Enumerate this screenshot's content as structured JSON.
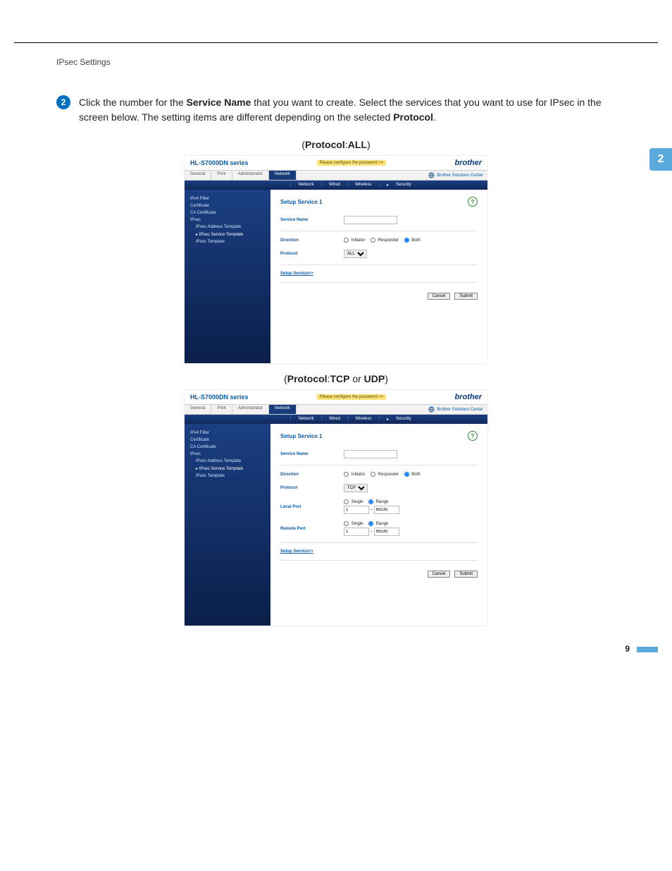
{
  "doc": {
    "header": "IPsec Settings",
    "step_bullet": "2",
    "step_text_prefix": "Click the number for the ",
    "step_bold1": "Service Name",
    "step_text_mid": " that you want to create. Select the services that you want to use for IPsec in the screen below. The setting items are different depending on the selected ",
    "step_bold2": "Protocol",
    "step_text_end": ".",
    "caption1_open": "(",
    "caption1_b1": "Protocol",
    "caption1_sep": ":",
    "caption1_b2": "ALL",
    "caption1_close": ")",
    "caption2_open": "(",
    "caption2_b1": "Protocol",
    "caption2_sep": ":",
    "caption2_b2": "TCP",
    "caption2_or": " or ",
    "caption2_b3": "UDP",
    "caption2_close": ")",
    "side_tab": "2",
    "page_number": "9"
  },
  "shot": {
    "product": "HL-S7000DN series",
    "warn": "Please configure the password >>",
    "brand": "brother",
    "solutions_link": "Brother Solutions Center",
    "tabs": {
      "general": "General",
      "print": "Print",
      "admin": "Administrator",
      "network": "Network"
    },
    "subnav": {
      "network": "Network",
      "wired": "Wired",
      "wireless": "Wireless",
      "security": "Security",
      "marker": "▸"
    },
    "side": {
      "ipv4": "IPv4 Filter",
      "cert": "Certificate",
      "cacert": "CA Certificate",
      "ipsec": "IPsec",
      "addr_tpl": "IPsec Address Template",
      "svc_tpl": "IPsec Service Template",
      "ipsec_tpl": "IPsec Template"
    },
    "panel": {
      "heading": "Setup Service 1",
      "svc_name_label": "Service Name",
      "direction_label": "Direction",
      "direction_opts": {
        "initiator": "Initiator",
        "responder": "Responder",
        "both": "Both"
      },
      "protocol_label": "Protocol",
      "protocol_all": "ALL",
      "protocol_tcp": "TCP",
      "local_port_label": "Local Port",
      "remote_port_label": "Remote Port",
      "port_opts": {
        "single": "Single",
        "range": "Range"
      },
      "port_from": "1",
      "port_dash": "–",
      "port_to": "65535",
      "setup_link": "Setup Service>>",
      "cancel": "Cancel",
      "submit": "Submit"
    }
  }
}
